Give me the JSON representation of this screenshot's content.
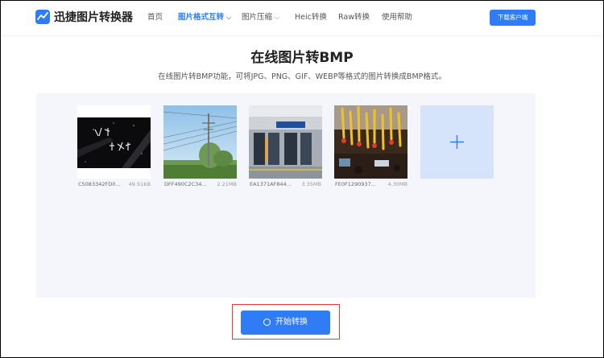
{
  "header": {
    "brand": "迅捷图片转换器",
    "nav": [
      {
        "label": "首页"
      },
      {
        "label": "图片格式互转"
      },
      {
        "label": "图片压缩"
      },
      {
        "label": "Heic转换"
      },
      {
        "label": "Raw转换"
      },
      {
        "label": "使用帮助"
      }
    ],
    "download_label": "下载客户端"
  },
  "main": {
    "title": "在线图片转BMP",
    "subtitle": "在线图片转BMP功能，可将JPG、PNG、GIF、WEBP等格式的图片转换成BMP格式。"
  },
  "files": [
    {
      "name": "C5083342FD0...",
      "size": "49.91KB"
    },
    {
      "name": "DFF490C2C34...",
      "size": "2.21MB"
    },
    {
      "name": "EA1371AF844...",
      "size": "3.35MB"
    },
    {
      "name": "FE0F1290937...",
      "size": "4.30MB"
    }
  ],
  "actions": {
    "start_label": "开始转换"
  },
  "colors": {
    "accent": "#2f7cf6",
    "highlight": "#e23a3a",
    "workspace_bg": "#f4f6fb",
    "add_tile_bg": "#d6e4fb"
  }
}
